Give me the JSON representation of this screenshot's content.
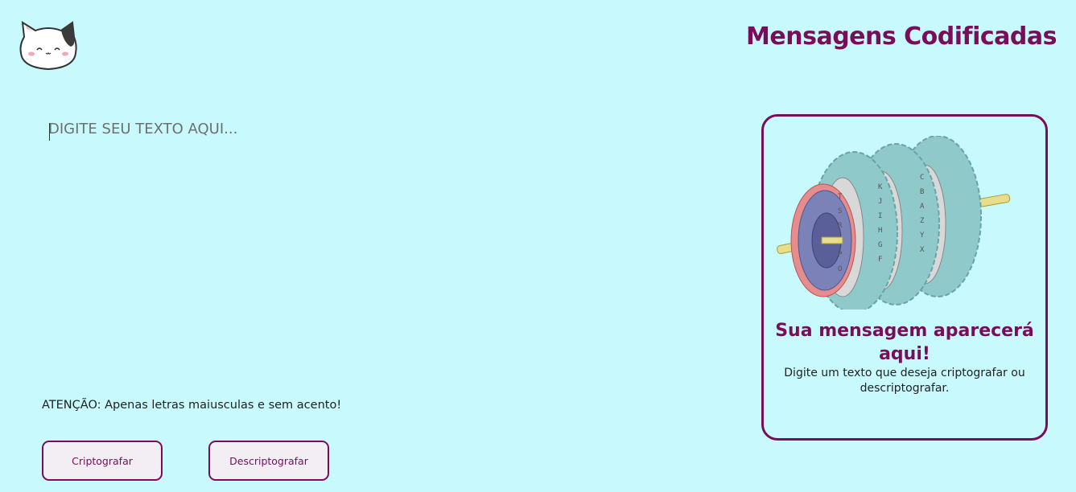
{
  "header": {
    "logo_icon": "cat-face-icon",
    "title": "Mensagens Codificadas"
  },
  "editor": {
    "placeholder": "DIGITE SEU TEXTO AQUI...",
    "value": ""
  },
  "warning": "ATENÇÃO: Apenas letras maiusculas e sem acento!",
  "buttons": {
    "encrypt_label": "Criptografar",
    "decrypt_label": "Descriptografar"
  },
  "output": {
    "image_icon": "cipher-wheel-icon",
    "title": "Sua mensagem aparecerá aqui!",
    "description": "Digite um texto que deseja criptografar ou descriptografar."
  },
  "colors": {
    "background": "#c8f9fd",
    "accent": "#7a0d5a",
    "button_bg": "#f2eef3"
  }
}
